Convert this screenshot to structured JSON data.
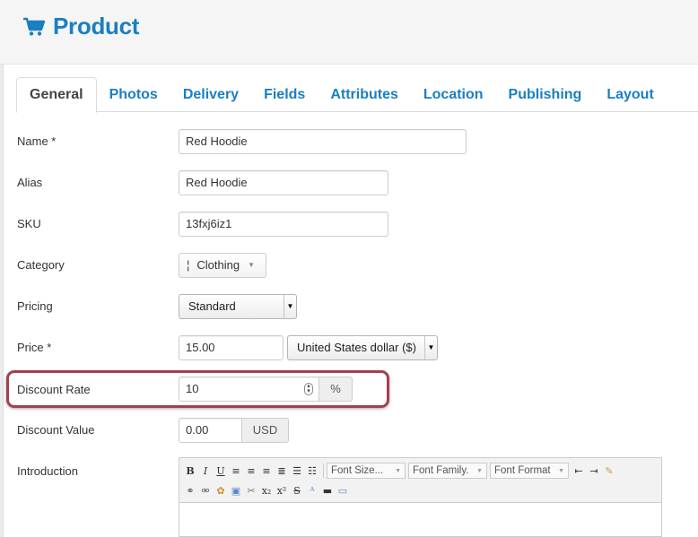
{
  "header": {
    "icon": "shopping-cart-icon",
    "title": "Product"
  },
  "tabs": [
    {
      "label": "General",
      "active": true
    },
    {
      "label": "Photos",
      "active": false
    },
    {
      "label": "Delivery",
      "active": false
    },
    {
      "label": "Fields",
      "active": false
    },
    {
      "label": "Attributes",
      "active": false
    },
    {
      "label": "Location",
      "active": false
    },
    {
      "label": "Publishing",
      "active": false
    },
    {
      "label": "Layout",
      "active": false
    }
  ],
  "form": {
    "name": {
      "label": "Name *",
      "value": "Red Hoodie"
    },
    "alias": {
      "label": "Alias",
      "value": "Red Hoodie"
    },
    "sku": {
      "label": "SKU",
      "value": "13fxj6iz1"
    },
    "category": {
      "label": "Category",
      "prefix": "¦",
      "value": "Clothing"
    },
    "pricing": {
      "label": "Pricing",
      "value": "Standard"
    },
    "price": {
      "label": "Price *",
      "value": "15.00",
      "currency": "United States dollar ($)"
    },
    "discount_rate": {
      "label": "Discount Rate",
      "value": "10",
      "unit": "%"
    },
    "discount_value": {
      "label": "Discount Value",
      "value": "0.00",
      "unit": "USD"
    },
    "introduction": {
      "label": "Introduction"
    }
  },
  "editor": {
    "toolbar_row1": [
      "B",
      "I",
      "U"
    ],
    "font_size": "Font Size...",
    "font_family": "Font Family.",
    "font_format": "Font Format"
  }
}
